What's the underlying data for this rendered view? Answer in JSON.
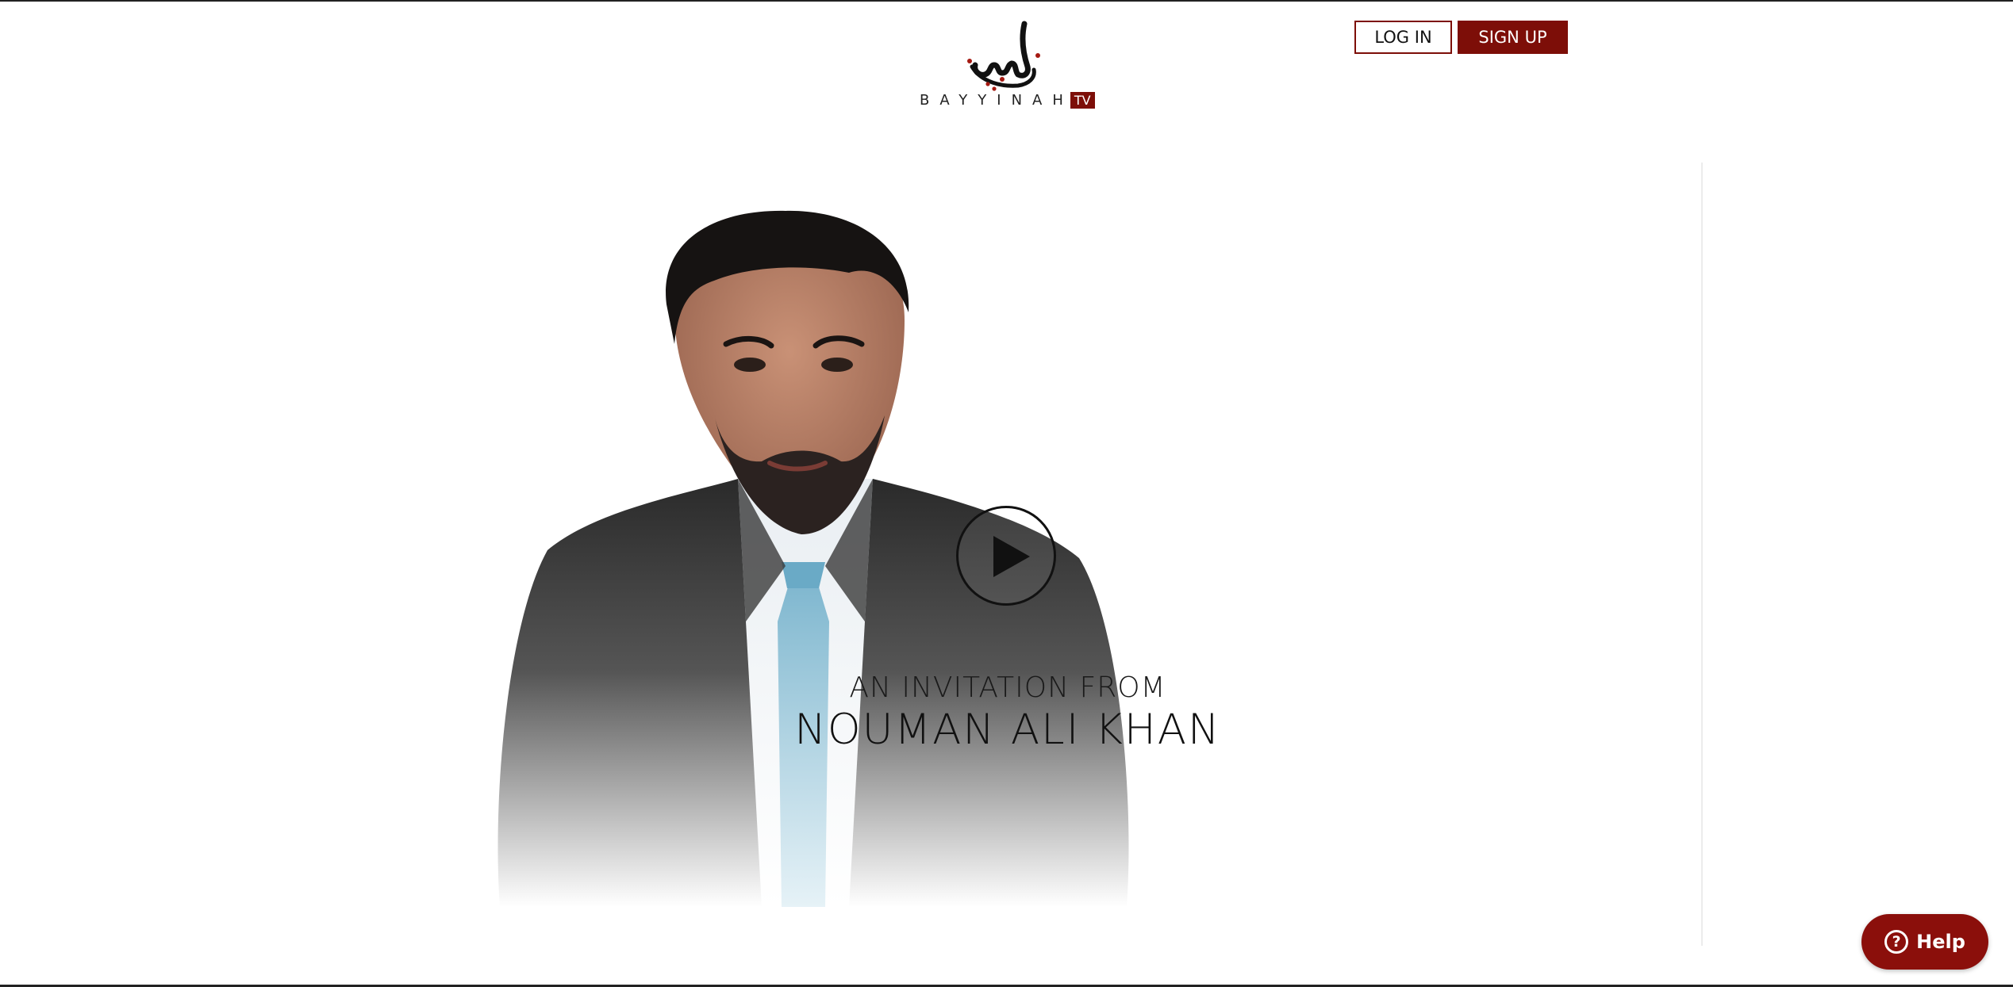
{
  "header": {
    "logo_wordmark": "BAYYINAH",
    "logo_badge": "TV",
    "login_label": "LOG IN",
    "signup_label": "SIGN UP"
  },
  "hero": {
    "invite_line": "AN INVITATION FROM",
    "name_line": "NOUMAN ALI KHAN"
  },
  "help": {
    "icon_glyph": "?",
    "label": "Help"
  },
  "icons": {
    "logo": "bayyinah-calligraphy-logo",
    "play": "play-icon",
    "help": "question-circle-icon"
  },
  "colors": {
    "brand": "#7d0e08",
    "help_button": "#8b0f0b"
  }
}
